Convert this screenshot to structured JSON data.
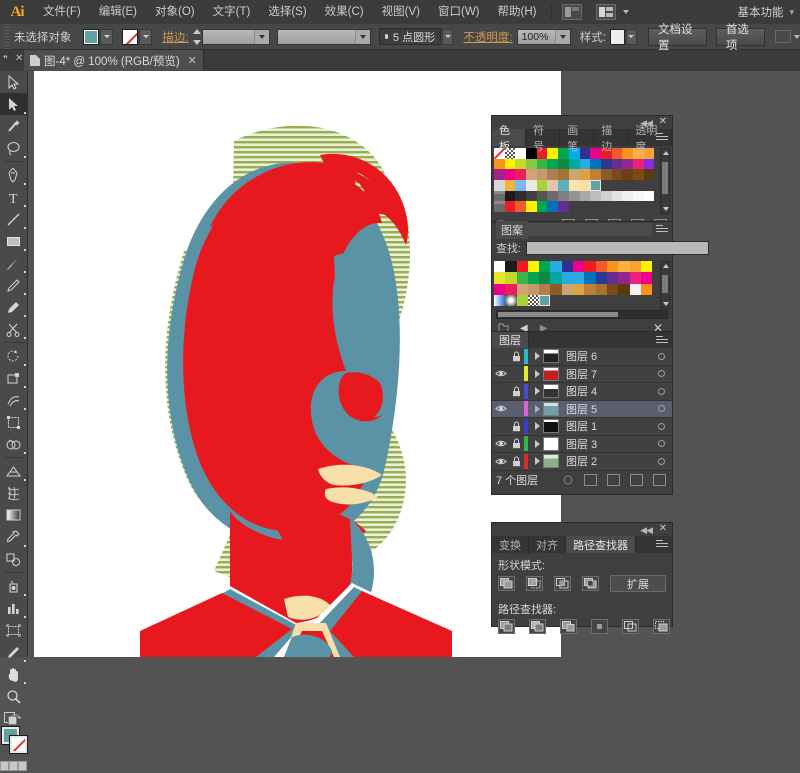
{
  "app": {
    "name": "Ai",
    "workspace": "基本功能"
  },
  "menubar": {
    "items": [
      {
        "label": "文件(F)"
      },
      {
        "label": "编辑(E)"
      },
      {
        "label": "对象(O)"
      },
      {
        "label": "文字(T)"
      },
      {
        "label": "选择(S)"
      },
      {
        "label": "效果(C)"
      },
      {
        "label": "视图(V)"
      },
      {
        "label": "窗口(W)"
      },
      {
        "label": "帮助(H)"
      }
    ],
    "bridge_icon": "bridge-icon",
    "arrange_icon": "arrange-documents-icon"
  },
  "controlbar": {
    "selection_status": "未选择对象",
    "fill_color": "#62a0a4",
    "stroke_color": "none",
    "stroke_label": "描边:",
    "stroke_weight": "",
    "stroke_profile": "",
    "brush_def": "",
    "opacity_label": "不透明度:",
    "opacity_value": "100%",
    "style_label": "样式:",
    "shape_label": "5 点圆形",
    "doc_setup_button": "文档设置",
    "preferences_button": "首选项",
    "extra_icon": "align-icon"
  },
  "document_tab": {
    "title": "图-4* @ 100% (RGB/预览)",
    "close_glyph": "✕"
  },
  "toolbar": {
    "tools": [
      {
        "name": "selection-tool",
        "selected": false
      },
      {
        "name": "direct-selection-tool",
        "selected": true
      },
      {
        "name": "magic-wand-tool",
        "selected": false
      },
      {
        "name": "lasso-tool",
        "selected": false
      },
      {
        "name": "pen-tool",
        "selected": false
      },
      {
        "name": "type-tool",
        "selected": false
      },
      {
        "name": "line-segment-tool",
        "selected": false
      },
      {
        "name": "rectangle-tool",
        "selected": false
      },
      {
        "name": "paintbrush-tool",
        "selected": false
      },
      {
        "name": "pencil-tool",
        "selected": false
      },
      {
        "name": "blob-brush-tool",
        "selected": false
      },
      {
        "name": "scissors-tool",
        "selected": false
      },
      {
        "name": "rotate-tool",
        "selected": false
      },
      {
        "name": "scale-tool",
        "selected": false
      },
      {
        "name": "width-tool",
        "selected": false
      },
      {
        "name": "free-transform-tool",
        "selected": false
      },
      {
        "name": "shape-builder-tool",
        "selected": false
      },
      {
        "name": "perspective-grid-tool",
        "selected": false
      },
      {
        "name": "mesh-tool",
        "selected": false
      },
      {
        "name": "gradient-tool",
        "selected": false
      },
      {
        "name": "eyedropper-tool",
        "selected": false
      },
      {
        "name": "blend-tool",
        "selected": false
      },
      {
        "name": "symbol-sprayer-tool",
        "selected": false
      },
      {
        "name": "column-graph-tool",
        "selected": false
      },
      {
        "name": "artboard-tool",
        "selected": false
      },
      {
        "name": "slice-tool",
        "selected": false
      },
      {
        "name": "hand-tool",
        "selected": false
      },
      {
        "name": "zoom-tool",
        "selected": false
      }
    ],
    "fill_color": "#62a0a4",
    "stroke_color": "#ffffff"
  },
  "swatches_panel": {
    "tabs": [
      {
        "label": "色板",
        "active": true
      },
      {
        "label": "符号",
        "active": false
      },
      {
        "label": "画笔",
        "active": false
      },
      {
        "label": "描边",
        "active": false
      },
      {
        "label": "透明度",
        "active": false
      }
    ],
    "rows": [
      [
        "none",
        "pattern",
        "#ffffff",
        "#000000",
        "#ed1c24",
        "#fff200",
        "#00a650",
        "#00aeef",
        "#2e3192",
        "#ec008c",
        "#ed1c24",
        "#f15a29",
        "#f7931e",
        "#fbb040",
        "#f9a03a"
      ],
      [
        "#f7941e",
        "#fff200",
        "#c5d92d",
        "#8dc63f",
        "#39b54a",
        "#00a651",
        "#0e8a44",
        "#00a99d",
        "#27aae1",
        "#0072bc",
        "#2b3990",
        "#662d91",
        "#92278f",
        "#ed217c",
        "#8a2be2"
      ],
      [
        "#a3238e",
        "#ec008c",
        "#ed1c5c",
        "#d4a373",
        "#c49a6c",
        "#b07d4f",
        "#a4732e",
        "#caa472",
        "#d9a441",
        "#c07f36",
        "#8c5a2b",
        "#7a4a1e",
        "#6b3f17",
        "#7c4a12",
        "#5b3a0f"
      ],
      [
        "#d8d8d8",
        "#f2b33d",
        "#7ab8e8",
        "#e8e8e8",
        "#a8d13a",
        "#e0c8a8",
        "#58b0c0",
        "#f7e4b0",
        "#f9dfa0",
        "#62a0a4",
        "#3f3f3f",
        "#3f3f3f",
        "#3f3f3f",
        "#3f3f3f",
        "#3f3f3f"
      ],
      [
        "folder",
        "#1b1b1b",
        "#2e2e2e",
        "#3f3f3f",
        "#555555",
        "#6b6b6b",
        "#808080",
        "#949494",
        "#a8a8a8",
        "#bdbdbd",
        "#d1d1d1",
        "#e2e2e2",
        "#efefef",
        "#f7f7f7",
        "#ffffff"
      ],
      [
        "folder",
        "#ed1c24",
        "#f15a29",
        "#fff200",
        "#00a650",
        "#0072bc",
        "#662d91",
        "#3f3f3f",
        "#3f3f3f",
        "#3f3f3f",
        "#3f3f3f",
        "#3f3f3f",
        "#3f3f3f",
        "#3f3f3f",
        "#3f3f3f"
      ]
    ],
    "selected_index": {
      "row": 3,
      "col": 9
    },
    "footer_icons": [
      "swatch-libraries-icon",
      "show-swatch-kinds-icon",
      "swatch-options-icon",
      "new-color-group-icon",
      "new-swatch-icon",
      "delete-swatch-icon"
    ]
  },
  "pattern_panel": {
    "title": "图案",
    "find_label": "查找:",
    "find_value": "",
    "rows": [
      [
        "#ffffff",
        "#1b1b1b",
        "#ed1c24",
        "#fff200",
        "#00a650",
        "#29abe2",
        "#2e3192",
        "#ec008c",
        "#ed1c24",
        "#f15a29",
        "#f7941e",
        "#fbb040",
        "#f9a03a",
        "#fff200"
      ],
      [
        "#e6e62e",
        "#c5d92d",
        "#39b54a",
        "#00a651",
        "#0e8a44",
        "#00a99d",
        "#27aae1",
        "#29abe2",
        "#0072bc",
        "#2b3990",
        "#662d91",
        "#92278f",
        "#ed217c",
        "#ec008c"
      ],
      [
        "#ec008c",
        "#ed1c5c",
        "#d4a373",
        "#c49a6c",
        "#b07d4f",
        "#8c5a2b",
        "#caa472",
        "#d9a441",
        "#c07f36",
        "#a4732e",
        "#7a4a1e",
        "#5b3a0f",
        "#f2f2f2",
        "#f7931e"
      ],
      [
        "gradient",
        "radial",
        "#a8d13a",
        "pattern",
        "selected",
        "",
        "",
        "",
        "",
        "",
        "",
        "",
        "",
        ""
      ]
    ],
    "footer_icons": [
      "pattern-libraries-icon",
      "prev-icon",
      "next-icon",
      "delete-pattern-icon"
    ]
  },
  "layers_panel": {
    "title": "图层",
    "layers": [
      {
        "name": "图层 6",
        "visible": false,
        "locked": true,
        "color": "#2bb7c8",
        "selected": false
      },
      {
        "name": "图层 7",
        "visible": true,
        "locked": false,
        "color": "#e8e830",
        "selected": false
      },
      {
        "name": "图层 4",
        "visible": false,
        "locked": true,
        "color": "#4a4ad8",
        "selected": false
      },
      {
        "name": "图层 5",
        "visible": true,
        "locked": false,
        "color": "#e060d8",
        "selected": true
      },
      {
        "name": "图层 1",
        "visible": false,
        "locked": true,
        "color": "#3a3ad0",
        "selected": false
      },
      {
        "name": "图层 3",
        "visible": true,
        "locked": true,
        "color": "#2fb84a",
        "selected": false
      },
      {
        "name": "图层 2",
        "visible": true,
        "locked": true,
        "color": "#e02a2a",
        "selected": false
      }
    ],
    "count_label": "7 个图层",
    "footer_icons": [
      "locate-object-icon",
      "make-clipping-mask-icon",
      "create-new-sublayer-icon",
      "create-new-layer-icon",
      "delete-layer-icon"
    ]
  },
  "pathfinder_panel": {
    "tabs": [
      {
        "label": "变换",
        "active": false
      },
      {
        "label": "对齐",
        "active": false
      },
      {
        "label": "路径查找器",
        "active": true
      }
    ],
    "shape_modes_label": "形状模式:",
    "shape_mode_buttons": [
      "unite-icon",
      "minus-front-icon",
      "intersect-icon",
      "exclude-icon"
    ],
    "expand_button": "扩展",
    "pathfinders_label": "路径查找器:",
    "pathfinder_buttons": [
      "divide-icon",
      "trim-icon",
      "merge-icon",
      "crop-icon",
      "outline-icon",
      "minus-back-icon"
    ]
  },
  "artwork": {
    "description": "pop-art portrait",
    "colors": {
      "red": "#e8191e",
      "teal": "#5b93a6",
      "cream": "#f6dfa8",
      "hatch_bg": "#eef0d4",
      "hatch_line": "#8fae55",
      "white": "#ffffff"
    }
  }
}
